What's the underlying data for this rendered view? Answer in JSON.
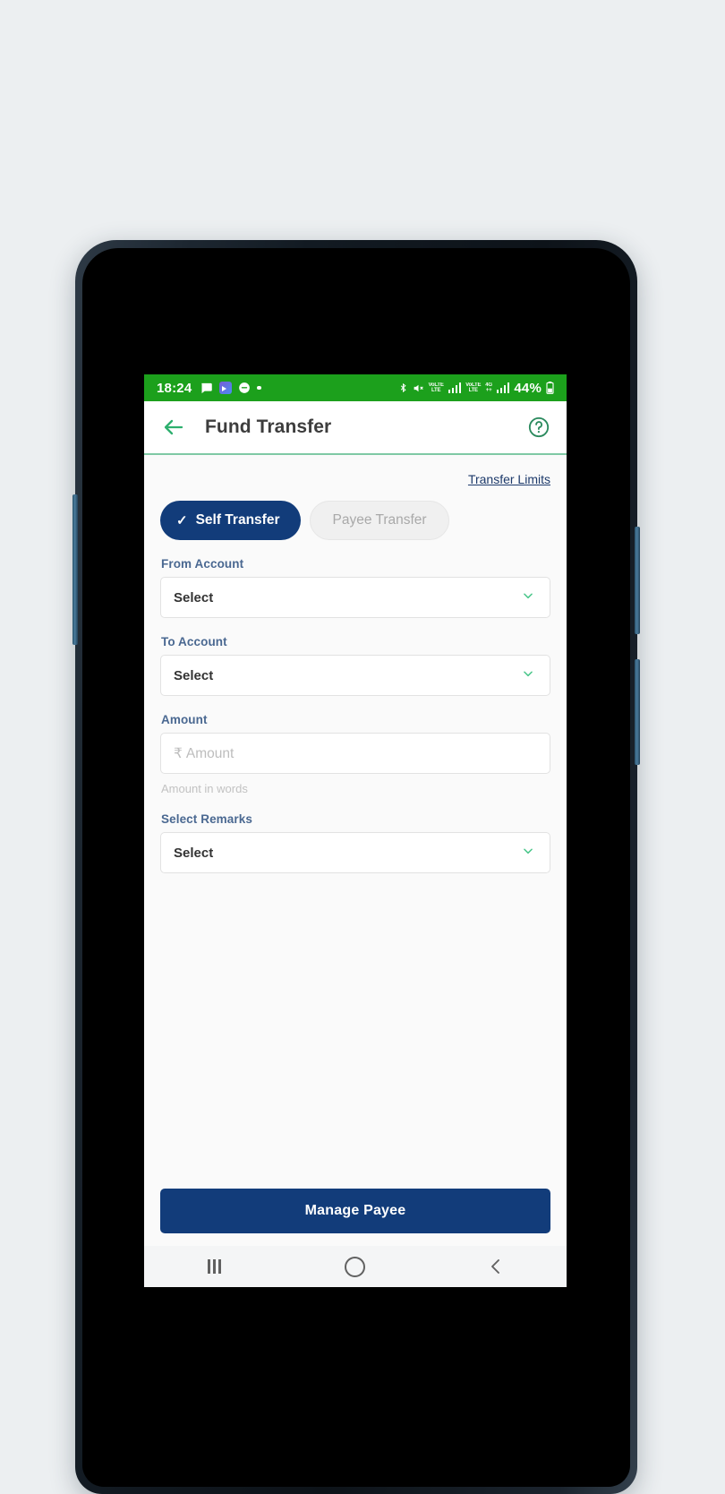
{
  "status_bar": {
    "time": "18:24",
    "battery_percent": "44%",
    "left_icons": [
      "message-icon",
      "video-app-icon",
      "chat-icon",
      "dot-icon"
    ],
    "right_icons": [
      "bluetooth-icon",
      "mute-icon",
      "volte-sim1-icon",
      "signal-sim1-icon",
      "volte-sim2-icon",
      "4g-icon",
      "signal-sim2-icon",
      "battery-icon"
    ],
    "background_color": "#1ca01c"
  },
  "header": {
    "title": "Fund Transfer",
    "back_icon": "back-arrow-icon",
    "help_icon": "help-circle-icon",
    "accent_color": "#2eaf6e"
  },
  "body": {
    "transfer_limits_link": "Transfer Limits",
    "tabs": [
      {
        "label": "Self Transfer",
        "selected": true,
        "icon": "check-icon"
      },
      {
        "label": "Payee Transfer",
        "selected": false
      }
    ],
    "fields": [
      {
        "label": "From Account",
        "type": "select",
        "value": "Select",
        "icon": "chevron-down-icon"
      },
      {
        "label": "To Account",
        "type": "select",
        "value": "Select",
        "icon": "chevron-down-icon"
      },
      {
        "label": "Amount",
        "type": "text",
        "currency": "₹",
        "placeholder": "Amount",
        "helper": "Amount in words"
      },
      {
        "label": "Select Remarks",
        "type": "select",
        "value": "Select",
        "icon": "chevron-down-icon"
      }
    ],
    "primary_button": "Manage Payee",
    "primary_color": "#123c7a"
  },
  "nav_bar": {
    "recents": "recents-icon",
    "home": "home-icon",
    "back": "back-icon"
  }
}
